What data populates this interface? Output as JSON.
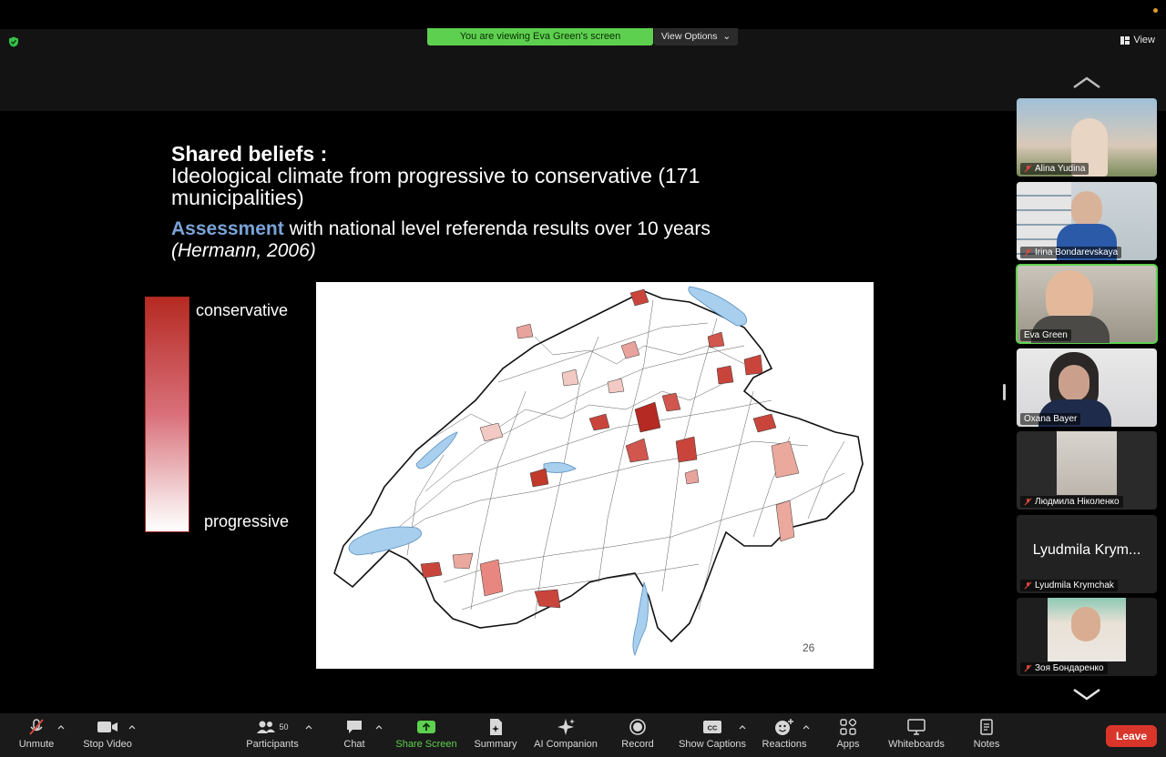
{
  "banner": {
    "viewing_text": "You are viewing Eva Green's screen",
    "view_options_label": "View Options",
    "view_label": "View"
  },
  "slide": {
    "title": "Shared beliefs :",
    "subtitle": "Ideological climate from progressive to conservative (171 municipalities)",
    "assessment_highlight": "Assessment",
    "assessment_rest": " with national level referenda results over 10 years",
    "citation": "(Hermann, 2006)",
    "legend_top": "conservative",
    "legend_bottom": "progressive",
    "page_number": "26",
    "colors": {
      "conservative": "#b52a22",
      "progressive": "#ffffff",
      "highlight": "#7aa4d8",
      "lake": "#a8cfee"
    }
  },
  "participants": [
    {
      "name": "Alina Yudina",
      "muted": true
    },
    {
      "name": "Irina Bondarevskaya",
      "muted": true
    },
    {
      "name": "Eva Green",
      "muted": false,
      "active": true
    },
    {
      "name": "Oxana Bayer",
      "muted": false
    },
    {
      "name": "Людмила Ніколенко",
      "muted": true
    },
    {
      "name": "Lyudmila Krymchak",
      "muted": true,
      "display_text": "Lyudmila Krym..."
    },
    {
      "name": "Зоя Бондаренко",
      "muted": true
    }
  ],
  "toolbar": {
    "unmute": "Unmute",
    "stop_video": "Stop Video",
    "participants": "Participants",
    "participants_count": "50",
    "chat": "Chat",
    "share_screen": "Share Screen",
    "summary": "Summary",
    "ai_companion": "AI Companion",
    "record": "Record",
    "show_captions": "Show Captions",
    "reactions": "Reactions",
    "apps": "Apps",
    "whiteboards": "Whiteboards",
    "notes": "Notes",
    "leave": "Leave"
  }
}
